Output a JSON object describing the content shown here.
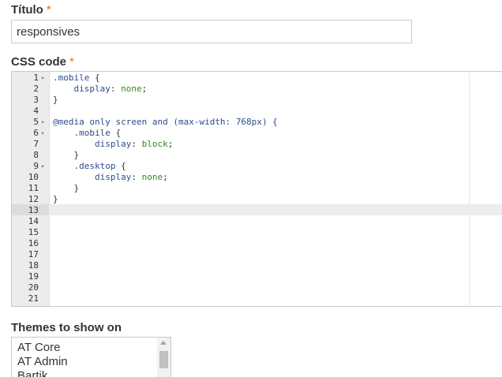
{
  "form": {
    "title_label": "Título",
    "required_marker": "*",
    "title_value": "responsives",
    "css_label": "CSS code",
    "themes_label": "Themes to show on"
  },
  "editor": {
    "active_line": 13,
    "lines": [
      {
        "n": "1",
        "fold": true,
        "tokens": [
          {
            "t": ".mobile",
            "c": "sel"
          },
          {
            "t": " {",
            "c": "punc"
          }
        ]
      },
      {
        "n": "2",
        "fold": false,
        "tokens": [
          {
            "t": "    display",
            "c": "prop"
          },
          {
            "t": ": ",
            "c": "punc"
          },
          {
            "t": "none",
            "c": "val"
          },
          {
            "t": ";",
            "c": "punc"
          }
        ]
      },
      {
        "n": "3",
        "fold": false,
        "tokens": [
          {
            "t": "}",
            "c": "punc"
          }
        ]
      },
      {
        "n": "4",
        "fold": false,
        "tokens": []
      },
      {
        "n": "5",
        "fold": true,
        "tokens": [
          {
            "t": "@media",
            "c": "at"
          },
          {
            "t": " only screen and (max-width: ",
            "c": "at"
          },
          {
            "t": "768px",
            "c": "num"
          },
          {
            "t": ") {",
            "c": "at"
          }
        ]
      },
      {
        "n": "6",
        "fold": true,
        "tokens": [
          {
            "t": "    .mobile",
            "c": "sel"
          },
          {
            "t": " {",
            "c": "punc"
          }
        ]
      },
      {
        "n": "7",
        "fold": false,
        "tokens": [
          {
            "t": "        display",
            "c": "prop"
          },
          {
            "t": ": ",
            "c": "punc"
          },
          {
            "t": "block",
            "c": "val"
          },
          {
            "t": ";",
            "c": "punc"
          }
        ]
      },
      {
        "n": "8",
        "fold": false,
        "tokens": [
          {
            "t": "    }",
            "c": "punc"
          }
        ]
      },
      {
        "n": "9",
        "fold": true,
        "tokens": [
          {
            "t": "    .desktop",
            "c": "sel"
          },
          {
            "t": " {",
            "c": "punc"
          }
        ]
      },
      {
        "n": "10",
        "fold": false,
        "tokens": [
          {
            "t": "        display",
            "c": "prop"
          },
          {
            "t": ": ",
            "c": "punc"
          },
          {
            "t": "none",
            "c": "val"
          },
          {
            "t": ";",
            "c": "punc"
          }
        ]
      },
      {
        "n": "11",
        "fold": false,
        "tokens": [
          {
            "t": "    }",
            "c": "punc"
          }
        ]
      },
      {
        "n": "12",
        "fold": false,
        "tokens": [
          {
            "t": "}",
            "c": "punc"
          }
        ]
      },
      {
        "n": "13",
        "fold": false,
        "tokens": []
      },
      {
        "n": "14",
        "fold": false,
        "tokens": []
      },
      {
        "n": "15",
        "fold": false,
        "tokens": []
      },
      {
        "n": "16",
        "fold": false,
        "tokens": []
      },
      {
        "n": "17",
        "fold": false,
        "tokens": []
      },
      {
        "n": "18",
        "fold": false,
        "tokens": []
      },
      {
        "n": "19",
        "fold": false,
        "tokens": []
      },
      {
        "n": "20",
        "fold": false,
        "tokens": []
      },
      {
        "n": "21",
        "fold": false,
        "tokens": []
      }
    ]
  },
  "themes": {
    "options": [
      "AT Core",
      "AT Admin",
      "Bartik"
    ]
  },
  "icons": {
    "fold": "fold-arrow-icon",
    "scroll_up": "scroll-up-arrow-icon"
  },
  "colors": {
    "required": "#e96b24",
    "selector": "#2d4d8c",
    "value": "#318a1f"
  }
}
